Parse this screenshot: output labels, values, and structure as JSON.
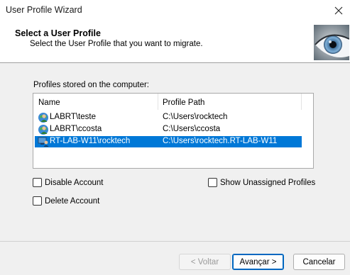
{
  "window": {
    "title": "User Profile Wizard"
  },
  "header": {
    "title": "Select a User Profile",
    "subtitle": "Select the User Profile that you want to migrate."
  },
  "profiles": {
    "group_label": "Profiles stored on the computer:",
    "columns": [
      "Name",
      "Profile Path"
    ],
    "rows": [
      {
        "name": "LABRT\\teste",
        "path": "C:\\Users\\rocktech",
        "selected": false
      },
      {
        "name": "LABRT\\ccosta",
        "path": "C:\\Users\\ccosta",
        "selected": false
      },
      {
        "name": "RT-LAB-W11\\rocktech",
        "path": "C:\\Users\\rocktech.RT-LAB-W11",
        "selected": true
      }
    ]
  },
  "options": {
    "disable_account": "Disable Account",
    "delete_account": "Delete Account",
    "show_unassigned": "Show Unassigned Profiles"
  },
  "buttons": {
    "back": "< Voltar",
    "next": "Avançar >",
    "cancel": "Cancelar"
  },
  "colors": {
    "selection": "#0078d7",
    "default_button": "#0067c0"
  },
  "icons": {
    "close": "close-icon",
    "eye": "eye-image",
    "user": "user-profile-icon"
  }
}
